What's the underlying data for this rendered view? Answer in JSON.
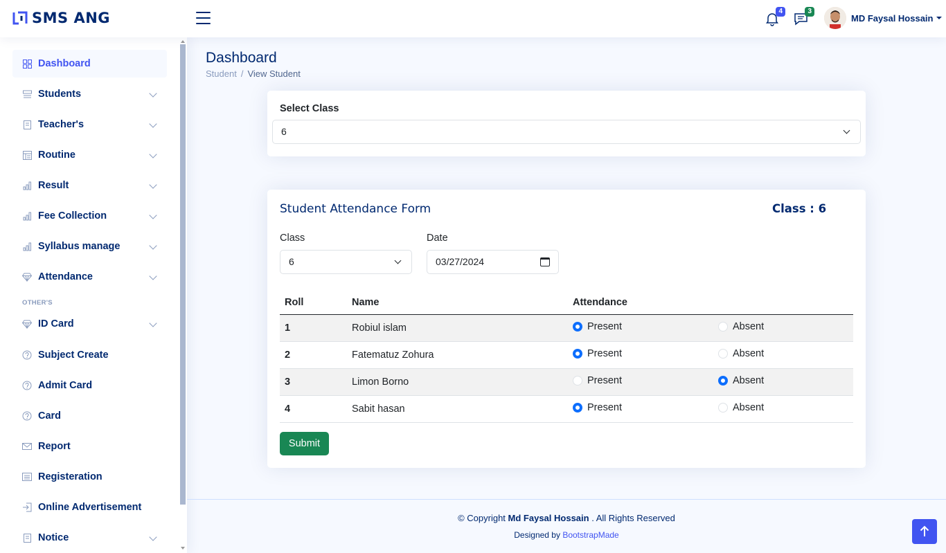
{
  "app": {
    "logo_text": "SMS ANG",
    "accent": "#4154f1",
    "navy": "#012970"
  },
  "header": {
    "notifications_icon": "bell-icon",
    "notifications_count": "4",
    "messages_icon": "chat-icon",
    "messages_count": "3",
    "user_name": "MD Faysal Hossain"
  },
  "sidebar": {
    "items": [
      {
        "label": "Dashboard",
        "icon": "grid-icon"
      },
      {
        "label": "Students",
        "icon": "menu-button-icon"
      },
      {
        "label": "Teacher's",
        "icon": "journal-icon"
      },
      {
        "label": "Routine",
        "icon": "layout-text-icon"
      },
      {
        "label": "Result",
        "icon": "bar-chart-icon"
      },
      {
        "label": "Fee Collection",
        "icon": "bar-chart-icon"
      },
      {
        "label": "Syllabus manage",
        "icon": "bar-chart-icon"
      },
      {
        "label": "Attendance",
        "icon": "gem-icon"
      }
    ],
    "heading": "OTHER'S",
    "items2": [
      {
        "label": "ID Card",
        "icon": "gem-icon"
      },
      {
        "label": "Subject Create",
        "icon": "question-circle-icon"
      },
      {
        "label": "Admit Card",
        "icon": "question-circle-icon"
      },
      {
        "label": "Card",
        "icon": "question-circle-icon"
      },
      {
        "label": "Report",
        "icon": "envelope-icon"
      },
      {
        "label": "Registeration",
        "icon": "card-list-icon"
      },
      {
        "label": "Online Advertisement",
        "icon": "box-arrow-in-right-icon"
      },
      {
        "label": "Notice",
        "icon": "journal-icon"
      }
    ]
  },
  "page": {
    "title": "Dashboard",
    "breadcrumb": [
      "Student",
      "View Student"
    ]
  },
  "select_class": {
    "label": "Select Class",
    "value": "6"
  },
  "form": {
    "title": "Student Attendance Form",
    "class_info": "Class : 6",
    "class_label": "Class",
    "class_value": "6",
    "date_label": "Date",
    "date_value": "03/27/2024",
    "columns": [
      "Roll",
      "Name",
      "Attendance"
    ],
    "present_label": "Present",
    "absent_label": "Absent",
    "rows": [
      {
        "roll": "1",
        "name": "Robiul islam",
        "status": "present"
      },
      {
        "roll": "2",
        "name": "Fatematuz Zohura",
        "status": "present"
      },
      {
        "roll": "3",
        "name": "Limon Borno",
        "status": "absent"
      },
      {
        "roll": "4",
        "name": "Sabit hasan",
        "status": "present"
      }
    ],
    "submit_label": "Submit"
  },
  "footer": {
    "copy_prefix": "© Copyright",
    "copy_name": "Md Faysal Hossain",
    "copy_suffix": ". All Rights Reserved",
    "designed_prefix": "Designed by",
    "designed_link": "BootstrapMade"
  }
}
